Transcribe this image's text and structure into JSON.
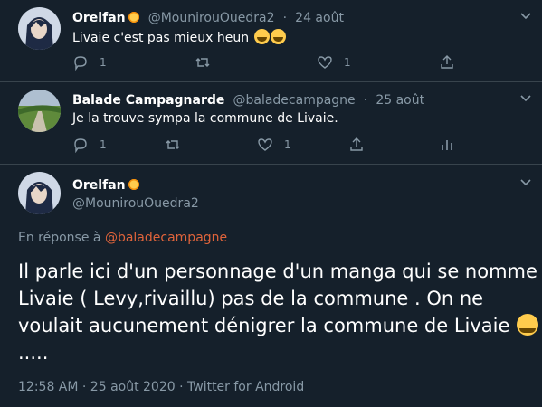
{
  "tweet1": {
    "name": "Orelfan",
    "handle": "@MounirouOuedra2",
    "date": "24 août",
    "text": "Livaie c'est pas mieux heun",
    "reply_count": "1",
    "like_count": "1"
  },
  "tweet2": {
    "name": "Balade Campagnarde",
    "handle": "@baladecampagne",
    "date": "25 août",
    "text": "Je la trouve sympa la commune de Livaie.",
    "reply_count": "1",
    "like_count": "1"
  },
  "main_tweet": {
    "name": "Orelfan",
    "handle": "@MounirouOuedra2",
    "reply_prefix": "En réponse à",
    "reply_to": "@baladecampagne",
    "text": "Il parle ici  d'un personnage d'un manga qui se nomme Livaie ( Levy,rivaillu) pas de la commune . On ne voulait aucunement dénigrer la commune de Livaie",
    "text_suffix": ".....",
    "meta": "12:58 AM · 25 août 2020 · Twitter for Android"
  },
  "colors": {
    "background": "#15202b",
    "secondary_text": "#8899a6",
    "link": "#e0643b",
    "divider": "#38444d"
  }
}
